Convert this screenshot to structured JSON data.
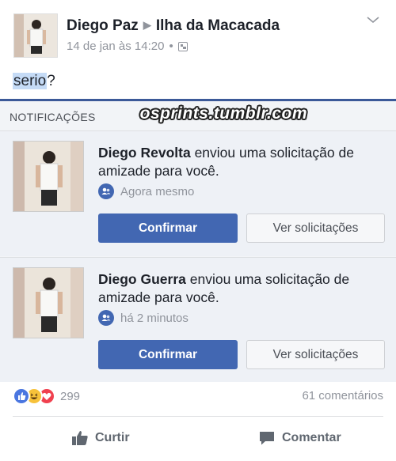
{
  "post": {
    "author": "Diego Paz",
    "group": "Ilha da Macacada",
    "timestamp": "14 de jan às 14:20",
    "dot": "•",
    "text": "serio",
    "text_suffix": "?"
  },
  "notifications": {
    "title": "NOTIFICAÇÕES",
    "watermark": "osprints.tumblr.com",
    "items": [
      {
        "name": "Diego Revolta",
        "message": "enviou uma solicitação de amizade para você.",
        "time": "Agora mesmo",
        "confirm_label": "Confirmar",
        "view_label": "Ver solicitações"
      },
      {
        "name": "Diego Guerra",
        "message": "enviou uma solicitação de amizade para você.",
        "time": "há 2 minutos",
        "confirm_label": "Confirmar",
        "view_label": "Ver solicitações"
      }
    ]
  },
  "footer": {
    "reaction_count": "299",
    "comments": "61 comentários",
    "like_label": "Curtir",
    "comment_label": "Comentar"
  },
  "colors": {
    "brand_blue": "#4267b2",
    "panel_border": "#3b5998",
    "muted": "#90949c"
  },
  "icons": [
    "chevron-down-icon",
    "privacy-icon",
    "friends-icon",
    "like-reaction-icon",
    "haha-reaction-icon",
    "love-reaction-icon",
    "thumbs-up-icon",
    "comment-icon"
  ]
}
